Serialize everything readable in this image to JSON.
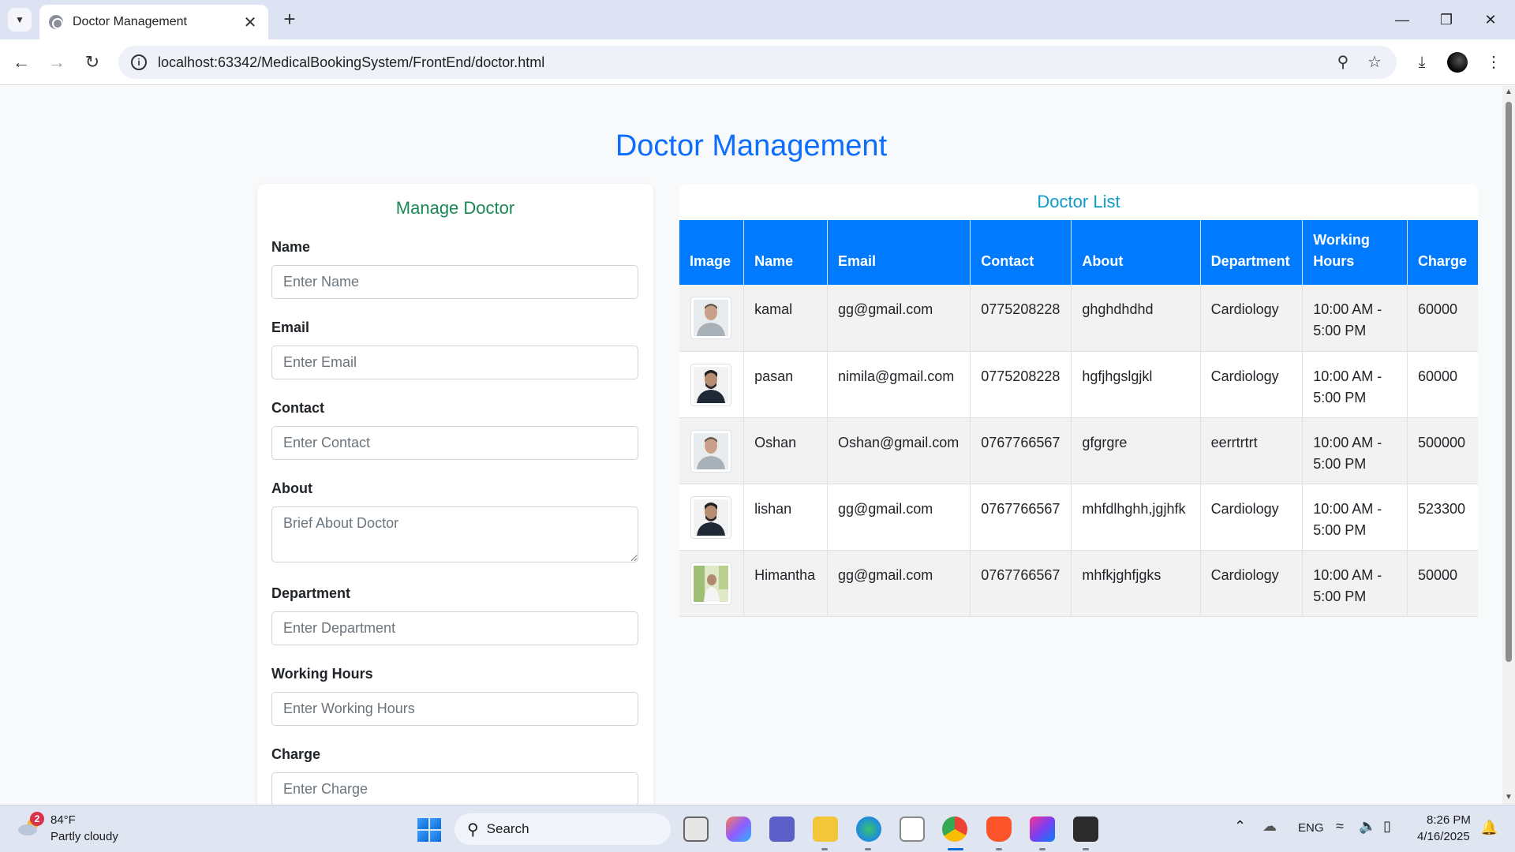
{
  "browser": {
    "tab_title": "Doctor Management",
    "url": "localhost:63342/MedicalBookingSystem/FrontEnd/doctor.html"
  },
  "page": {
    "title": "Doctor Management"
  },
  "form": {
    "title": "Manage Doctor",
    "fields": {
      "name": {
        "label": "Name",
        "placeholder": "Enter Name",
        "value": ""
      },
      "email": {
        "label": "Email",
        "placeholder": "Enter Email",
        "value": ""
      },
      "contact": {
        "label": "Contact",
        "placeholder": "Enter Contact",
        "value": ""
      },
      "about": {
        "label": "About",
        "placeholder": "Brief About Doctor",
        "value": ""
      },
      "department": {
        "label": "Department",
        "placeholder": "Enter Department",
        "value": ""
      },
      "working_hours": {
        "label": "Working Hours",
        "placeholder": "Enter Working Hours",
        "value": ""
      },
      "charge": {
        "label": "Charge",
        "placeholder": "Enter Charge",
        "value": ""
      }
    }
  },
  "list": {
    "title": "Doctor List",
    "columns": [
      "Image",
      "Name",
      "Email",
      "Contact",
      "About",
      "Department",
      "Working Hours",
      "Charge"
    ],
    "rows": [
      {
        "photo": "doctor-photo-light",
        "name": "kamal",
        "email": "gg@gmail.com",
        "contact": "0775208228",
        "about": "ghghdhdhd",
        "department": "Cardiology",
        "working_hours": "10:00 AM - 5:00 PM",
        "charge": "60000"
      },
      {
        "photo": "doctor-photo-dark",
        "name": "pasan",
        "email": "nimila@gmail.com",
        "contact": "0775208228",
        "about": "hgfjhgslgjkl",
        "department": "Cardiology",
        "working_hours": "10:00 AM - 5:00 PM",
        "charge": "60000"
      },
      {
        "photo": "doctor-photo-light",
        "name": "Oshan",
        "email": "Oshan@gmail.com",
        "contact": "0767766567",
        "about": "gfgrgre",
        "department": "eerrtrtrt",
        "working_hours": "10:00 AM - 5:00 PM",
        "charge": "500000"
      },
      {
        "photo": "doctor-photo-dark",
        "name": "lishan",
        "email": "gg@gmail.com",
        "contact": "0767766567",
        "about": "mhfdlhghh,jgjhfk",
        "department": "Cardiology",
        "working_hours": "10:00 AM - 5:00 PM",
        "charge": "523300"
      },
      {
        "photo": "doctor-photo-outdoor",
        "name": "Himantha",
        "email": "gg@gmail.com",
        "contact": "0767766567",
        "about": "mhfkjghfjgks",
        "department": "Cardiology",
        "working_hours": "10:00 AM - 5:00 PM",
        "charge": "50000"
      }
    ]
  },
  "taskbar": {
    "weather_badge": "2",
    "weather_temp": "84°F",
    "weather_desc": "Partly cloudy",
    "search_label": "Search",
    "language": "ENG",
    "time": "8:26 PM",
    "date": "4/16/2025"
  },
  "colors": {
    "primary": "#0d6efd",
    "table_header": "#007bff",
    "form_title": "#198754",
    "list_title": "#0d9bcb"
  }
}
